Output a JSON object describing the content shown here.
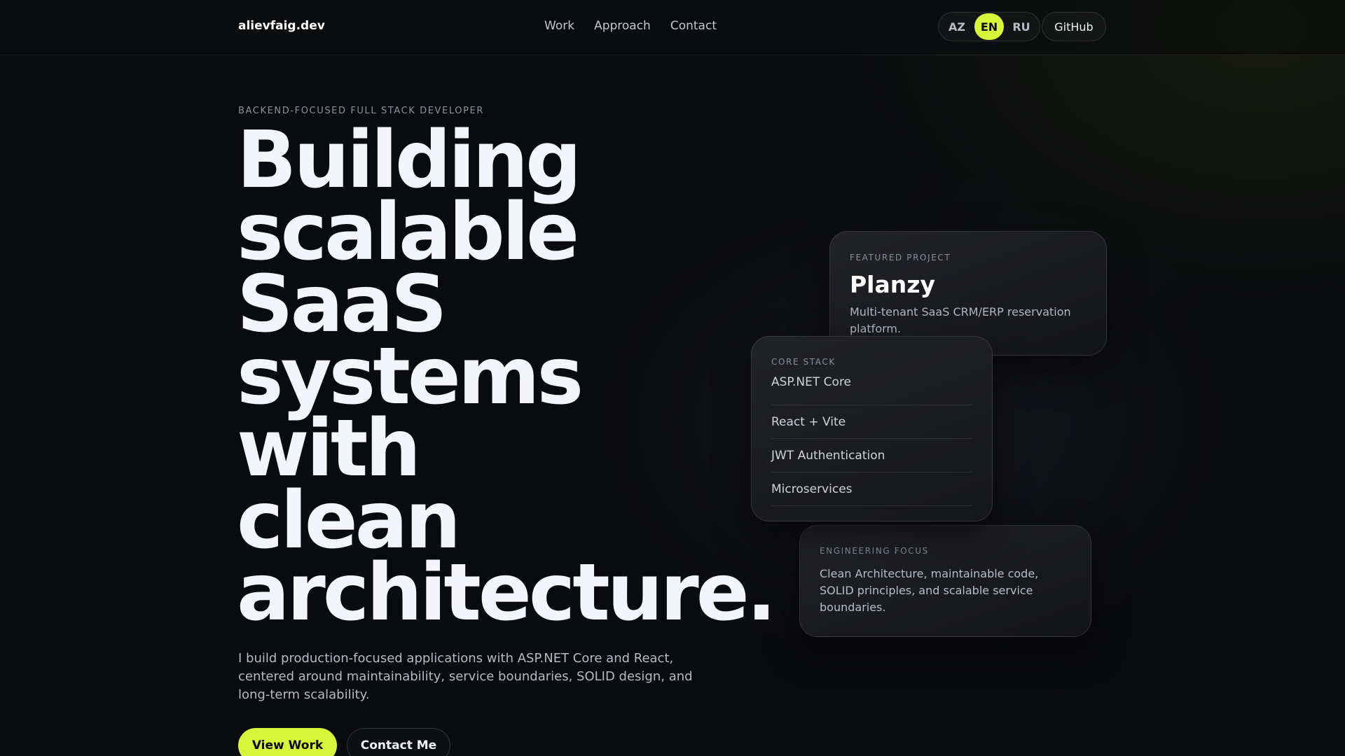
{
  "header": {
    "brand": "alievfaig.dev",
    "nav": [
      {
        "label": "Work"
      },
      {
        "label": "Approach"
      },
      {
        "label": "Contact"
      }
    ],
    "languages": [
      {
        "label": "AZ",
        "active": false
      },
      {
        "label": "EN",
        "active": true
      },
      {
        "label": "RU",
        "active": false
      }
    ],
    "github_label": "GitHub"
  },
  "hero": {
    "eyebrow": "BACKEND-FOCUSED FULL STACK DEVELOPER",
    "title_lines": [
      "Building",
      "scalable",
      "SaaS",
      "systems",
      "with",
      "clean",
      "architecture."
    ],
    "description": "I build production-focused applications with ASP.NET Core and React, centered around maintainability, service boundaries, SOLID design, and long-term scalability.",
    "primary_cta": "View Work",
    "secondary_cta": "Contact Me"
  },
  "featured_card": {
    "label": "FEATURED PROJECT",
    "title": "Planzy",
    "description": "Multi-tenant SaaS CRM/ERP reservation platform."
  },
  "stack_card": {
    "label": "CORE STACK",
    "items": [
      "ASP.NET Core",
      "React + Vite",
      "JWT Authentication",
      "Microservices"
    ]
  },
  "focus_card": {
    "label": "ENGINEERING FOCUS",
    "description": "Clean Architecture, maintainable code, SOLID principles, and scalable service boundaries."
  },
  "colors": {
    "accent": "#d7f53a",
    "background": "#0a0b0e",
    "text": "#f4f5fa"
  }
}
